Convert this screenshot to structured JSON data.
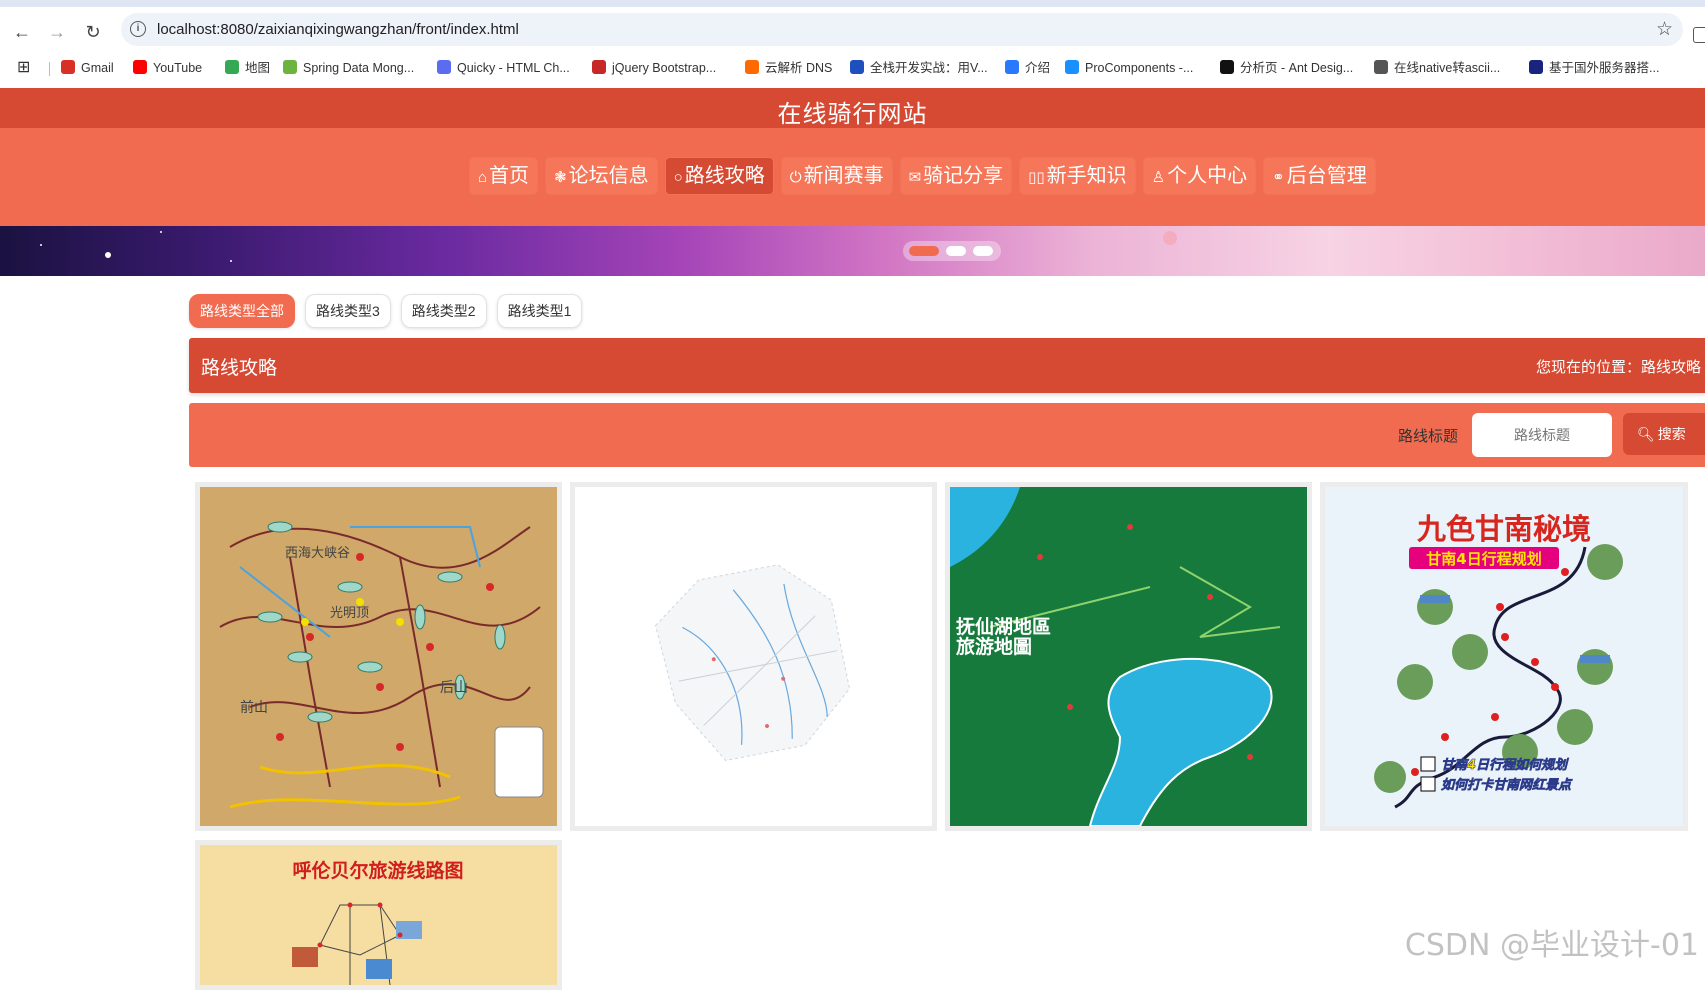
{
  "browser": {
    "url": "localhost:8080/zaixianqixingwangzhan/front/index.html",
    "bookmarks": [
      {
        "label": "Gmail",
        "color": "#d93025"
      },
      {
        "label": "YouTube",
        "color": "#ff0000"
      },
      {
        "label": "地图",
        "color": "#34a853"
      },
      {
        "label": "Spring Data Mong...",
        "color": "#6db33f"
      },
      {
        "label": "Quicky - HTML Ch...",
        "color": "#5b6cf0"
      },
      {
        "label": "jQuery Bootstrap...",
        "color": "#c62828"
      },
      {
        "label": "云解析 DNS",
        "color": "#ff6a00"
      },
      {
        "label": "全栈开发实战：用V...",
        "color": "#1e4fbf"
      },
      {
        "label": "介绍",
        "color": "#2979ff"
      },
      {
        "label": "ProComponents -...",
        "color": "#1890ff"
      },
      {
        "label": "分析页 - Ant Desig...",
        "color": "#111111"
      },
      {
        "label": "在线native转ascii...",
        "color": "#555555"
      },
      {
        "label": "基于国外服务器搭...",
        "color": "#1a237e"
      }
    ]
  },
  "site": {
    "title": "在线骑行网站",
    "nav": [
      {
        "icon": "⌂",
        "label": "首页",
        "active": false
      },
      {
        "icon": "❃",
        "label": "论坛信息",
        "active": false
      },
      {
        "icon": "○",
        "label": "路线攻略",
        "active": true
      },
      {
        "icon": "⏻",
        "label": "新闻赛事",
        "active": false
      },
      {
        "icon": "✉",
        "label": "骑记分享",
        "active": false
      },
      {
        "icon": "▯▯",
        "label": "新手知识",
        "active": false
      },
      {
        "icon": "♙",
        "label": "个人中心",
        "active": false
      },
      {
        "icon": "⚭",
        "label": "后台管理",
        "active": false
      }
    ]
  },
  "filters": {
    "tabs": [
      "路线类型全部",
      "路线类型3",
      "路线类型2",
      "路线类型1"
    ],
    "active_index": 0
  },
  "section": {
    "title": "路线攻略",
    "location_prefix": "您现在的位置：",
    "location": "路线攻略"
  },
  "search": {
    "label": "路线标题",
    "placeholder": "路线标题",
    "button": "搜索"
  },
  "cards": [
    {
      "title": "",
      "caption_left": "前山",
      "caption_right": "后山",
      "caption_top": "西海大峡谷",
      "caption_mid": "光明顶"
    },
    {
      "title": ""
    },
    {
      "title": "抚仙湖地區\n旅游地圖"
    },
    {
      "title": "九色甘南秘境",
      "subtitle": "甘南4日行程规划",
      "line1": "甘南4日行程如何规划",
      "line2": "如何打卡甘南网红景点"
    },
    {
      "title": "呼伦贝尔旅游线路图"
    }
  ],
  "watermark": "CSDN @毕业设计-01"
}
